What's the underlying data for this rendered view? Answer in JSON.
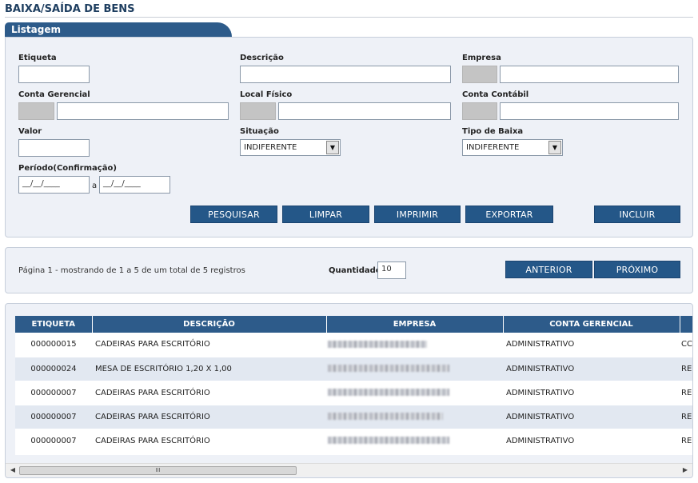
{
  "page": {
    "title": "BAIXA/SAÍDA DE BENS",
    "tab_label": "Listagem"
  },
  "filters": {
    "etiqueta": {
      "label": "Etiqueta",
      "value": ""
    },
    "descricao": {
      "label": "Descrição",
      "value": ""
    },
    "empresa": {
      "label": "Empresa",
      "value": ""
    },
    "conta_gerencial": {
      "label": "Conta Gerencial",
      "value": ""
    },
    "local_fisico": {
      "label": "Local Físico",
      "value": ""
    },
    "conta_contabil": {
      "label": "Conta Contábil",
      "value": ""
    },
    "valor": {
      "label": "Valor",
      "value": ""
    },
    "situacao": {
      "label": "Situação",
      "selected": "INDIFERENTE"
    },
    "tipo_baixa": {
      "label": "Tipo de Baixa",
      "selected": "INDIFERENTE"
    },
    "periodo": {
      "label": "Período(Confirmação)",
      "from": "__/__/____",
      "separator": "a",
      "to": "__/__/____"
    }
  },
  "actions": {
    "pesquisar": "PESQUISAR",
    "limpar": "LIMPAR",
    "imprimir": "IMPRIMIR",
    "exportar": "EXPORTAR",
    "incluir": "INCLUIR"
  },
  "pager": {
    "status": "Página 1 - mostrando de 1 a 5 de um total de 5 registros",
    "quantidade_label": "Quantidade",
    "quantidade_value": "10",
    "anterior": "ANTERIOR",
    "proximo": "PRÓXIMO"
  },
  "grid": {
    "columns": [
      "ETIQUETA",
      "DESCRIÇÃO",
      "EMPRESA",
      "CONTA GERENCIAL"
    ],
    "rows": [
      {
        "etiqueta": "000000015",
        "descricao": "CADEIRAS  PARA ESCRITÓRIO",
        "conta": "ADMINISTRATIVO",
        "extra": "CC"
      },
      {
        "etiqueta": "000000024",
        "descricao": "MESA DE ESCRITÓRIO 1,20 X 1,00",
        "conta": "ADMINISTRATIVO",
        "extra": "RE"
      },
      {
        "etiqueta": "000000007",
        "descricao": "CADEIRAS PARA ESCRITÓRIO",
        "conta": "ADMINISTRATIVO",
        "extra": "RE"
      },
      {
        "etiqueta": "000000007",
        "descricao": "CADEIRAS PARA ESCRITÓRIO",
        "conta": "ADMINISTRATIVO",
        "extra": "RE"
      },
      {
        "etiqueta": "000000007",
        "descricao": "CADEIRAS PARA ESCRITÓRIO",
        "conta": "ADMINISTRATIVO",
        "extra": "RE"
      }
    ],
    "scroll_thumb": "III"
  },
  "colors": {
    "accent": "#245788",
    "header": "#2d5b8a",
    "panel": "#eef1f7",
    "row_alt": "#e2e8f1"
  }
}
